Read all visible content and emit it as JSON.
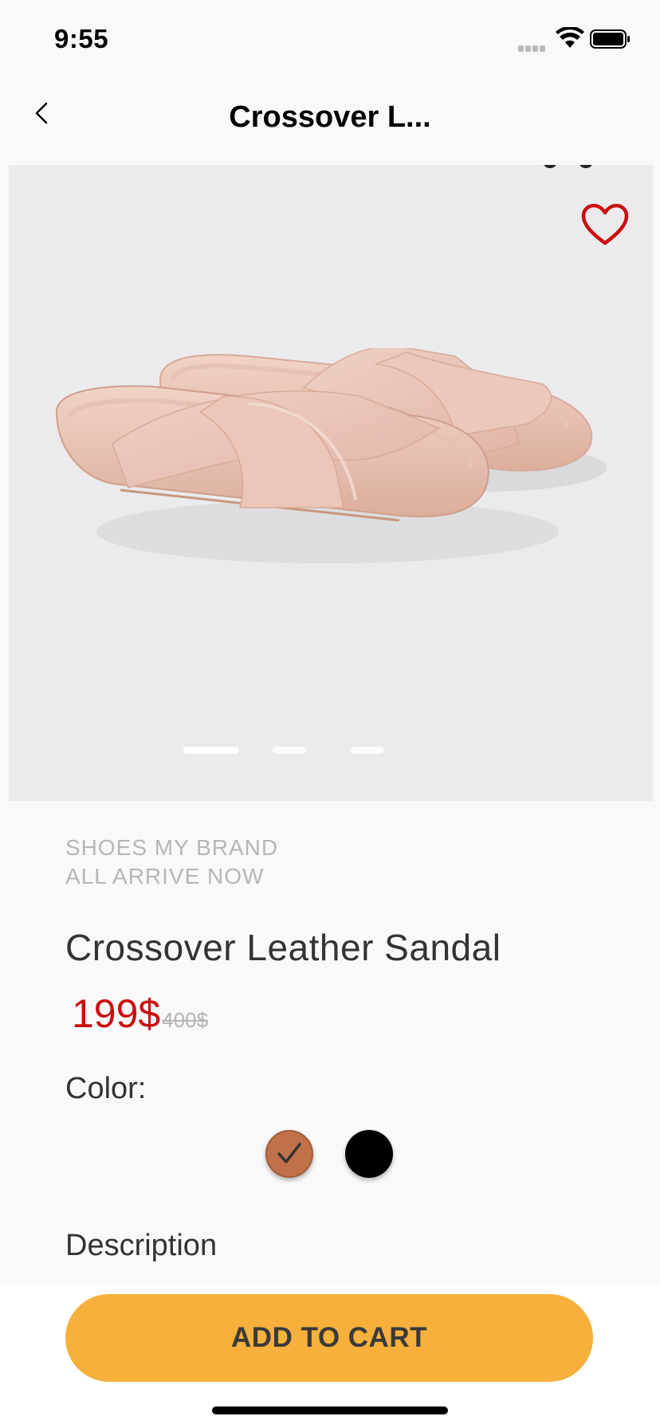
{
  "status_bar": {
    "time": "9:55"
  },
  "nav": {
    "title": "Crossover L...",
    "back_icon": "chevron-left-icon"
  },
  "hero": {
    "favorite_icon": "heart-outline-icon",
    "favorite_color": "#cc0e0e",
    "image_subject": "pink crossover leather sandals",
    "pager": {
      "count": 3,
      "active_index": 0
    }
  },
  "product": {
    "brand_line_1": "SHOES MY BRAND",
    "brand_line_2": "ALL ARRIVE NOW",
    "name": "Crossover Leather Sandal",
    "price": "199$",
    "old_price": "400$",
    "price_color": "#cc0e0e"
  },
  "color_section": {
    "label": "Color:",
    "options": [
      {
        "name": "brown",
        "hex": "#c0714a",
        "selected": true
      },
      {
        "name": "black",
        "hex": "#000000",
        "selected": false
      }
    ]
  },
  "description": {
    "label": "Description"
  },
  "cta": {
    "label": "ADD TO CART",
    "color": "#f6b03b"
  }
}
